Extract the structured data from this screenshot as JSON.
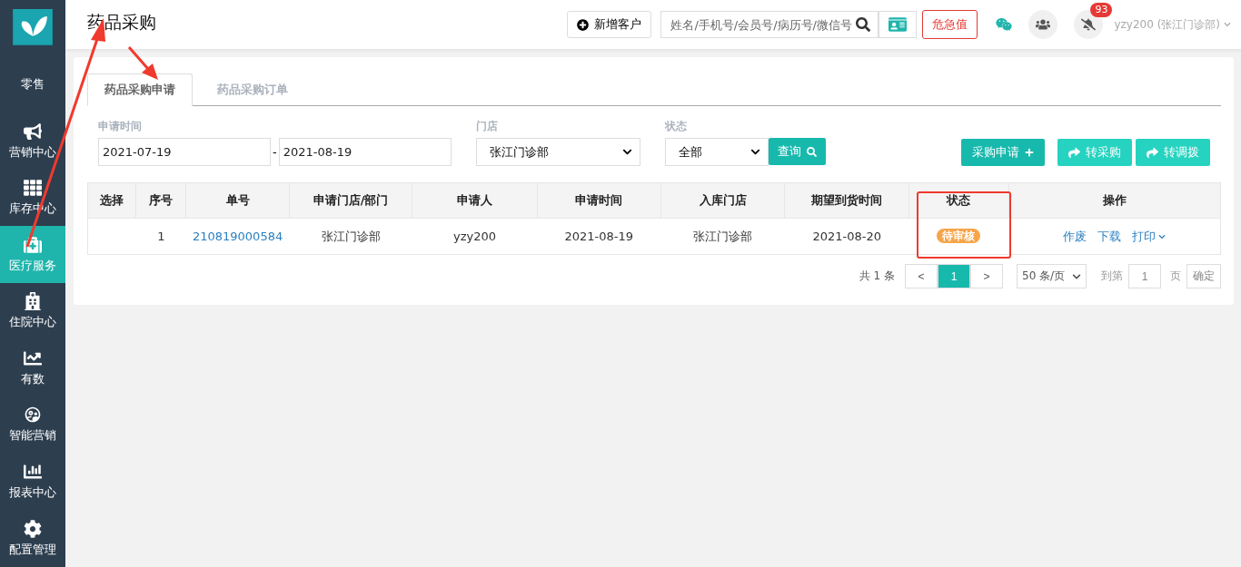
{
  "sidebar": {
    "items": [
      {
        "label": "零售",
        "selected": false
      },
      {
        "label": "营销中心",
        "selected": false
      },
      {
        "label": "库存中心",
        "selected": false
      },
      {
        "label": "医疗服务",
        "selected": true
      },
      {
        "label": "住院中心",
        "selected": false
      },
      {
        "label": "有数",
        "selected": false
      },
      {
        "label": "智能营销",
        "selected": false
      },
      {
        "label": "报表中心",
        "selected": false
      },
      {
        "label": "配置管理",
        "selected": false
      }
    ]
  },
  "header": {
    "title": "药品采购",
    "add_customer_button": "新增客户",
    "search": {
      "placeholder": "姓名/手机号/会员号/病历号/微信号"
    },
    "alert_button": "危急值",
    "notification_count": "93",
    "user": "yzy200 (张江门诊部)"
  },
  "tabs": [
    {
      "label": "药品采购申请",
      "selected": true
    },
    {
      "label": "药品采购订单",
      "selected": false
    }
  ],
  "filters": {
    "date_label": "申请时间",
    "date_from": "2021-07-19",
    "date_separator": "-",
    "date_to": "2021-08-19",
    "store_label": "门店",
    "store_value": "张江门诊部",
    "status_label": "状态",
    "status_value": "全部",
    "query_button": "查询"
  },
  "actions": [
    {
      "label": "采购申请",
      "kind": "add"
    },
    {
      "label": "转采购",
      "kind": "forward"
    },
    {
      "label": "转调拨",
      "kind": "forward"
    }
  ],
  "table": {
    "columns": [
      "选择",
      "序号",
      "单号",
      "申请门店/部门",
      "申请人",
      "申请时间",
      "入库门店",
      "期望到货时间",
      "状态",
      "操作"
    ],
    "rows": [
      {
        "index": "1",
        "number": "210819000584",
        "store": "张江门诊部",
        "applicant": "yzy200",
        "applied": "2021-08-19",
        "warehouse": "张江门诊部",
        "expected": "2021-08-20",
        "status": {
          "label": "待审核",
          "color": "#f7a54a"
        },
        "operations": [
          "作废",
          "下载",
          "打印"
        ]
      }
    ]
  },
  "pagination": {
    "total": "共 1 条",
    "prev": "<",
    "pages": [
      {
        "label": "1",
        "selected": true
      }
    ],
    "next": ">",
    "page_size": "50 条/页",
    "goto": "到第",
    "goto_value": "1",
    "page_unit": "页",
    "confirm": "确定"
  }
}
